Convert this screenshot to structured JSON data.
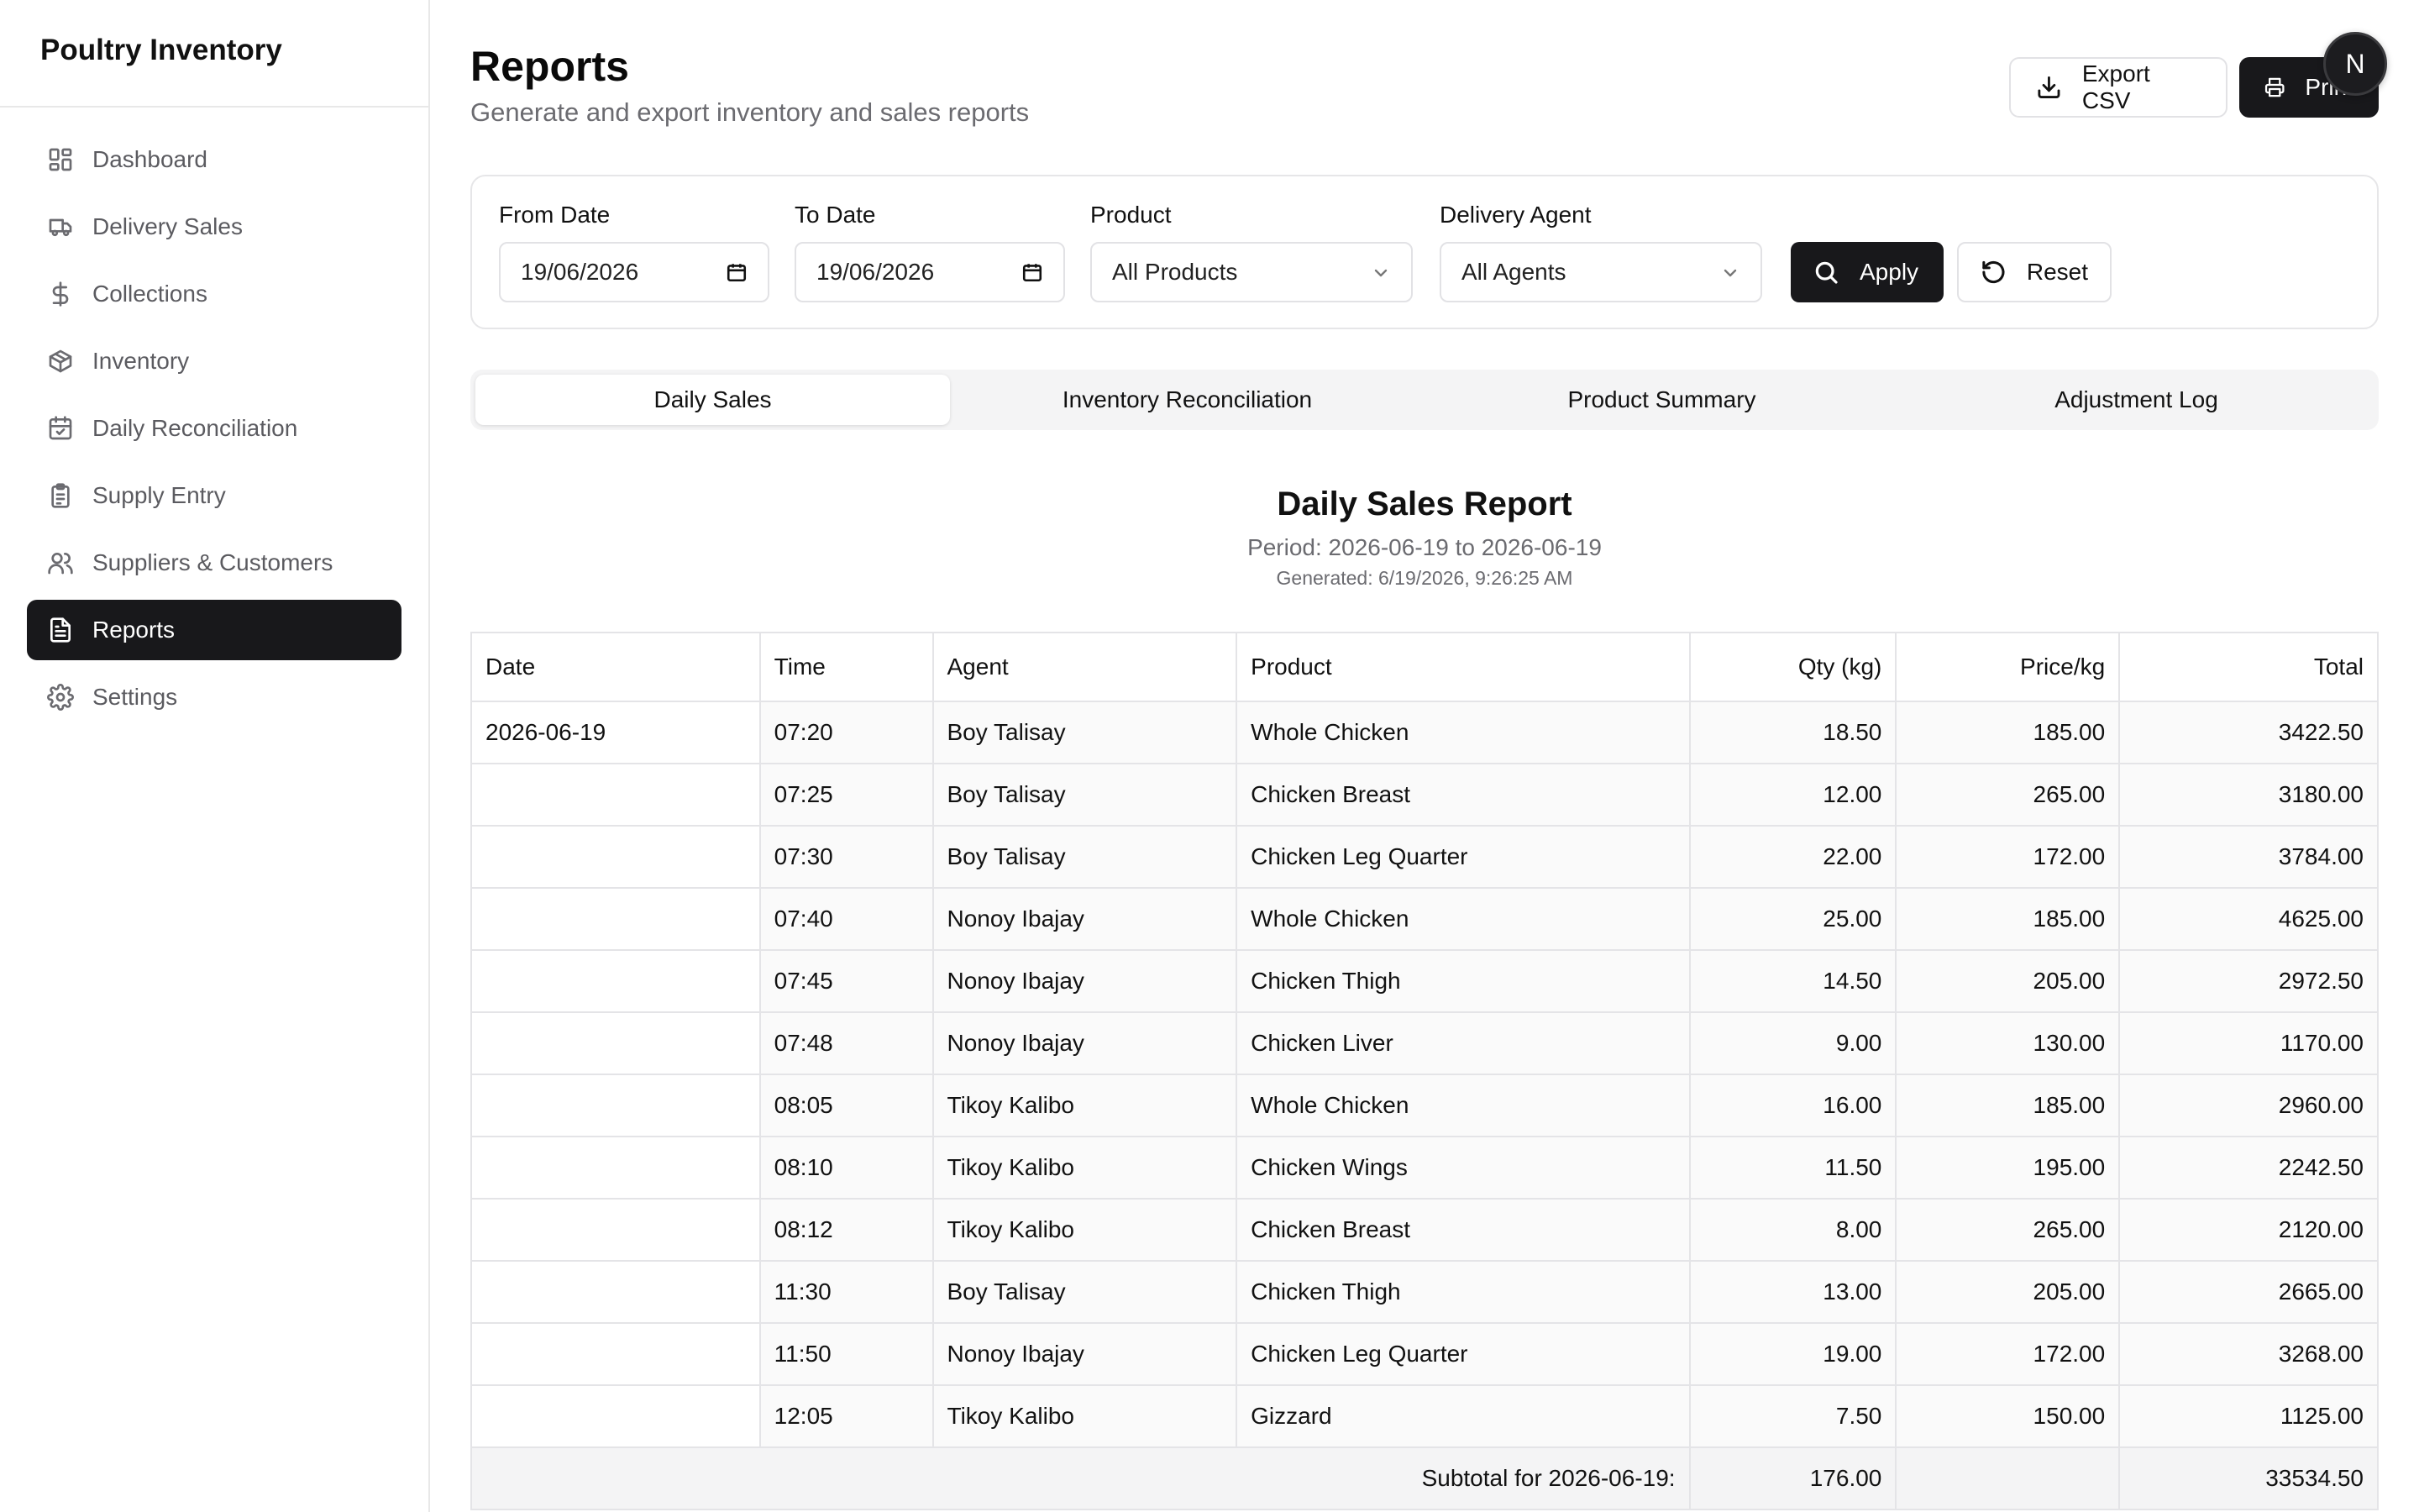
{
  "app": {
    "title": "Poultry Inventory"
  },
  "sidebar": {
    "items": [
      {
        "label": "Dashboard",
        "icon": "dashboard-icon"
      },
      {
        "label": "Delivery Sales",
        "icon": "truck-icon"
      },
      {
        "label": "Collections",
        "icon": "dollar-icon"
      },
      {
        "label": "Inventory",
        "icon": "package-icon"
      },
      {
        "label": "Daily Reconciliation",
        "icon": "calendar-check-icon"
      },
      {
        "label": "Supply Entry",
        "icon": "clipboard-icon"
      },
      {
        "label": "Suppliers & Customers",
        "icon": "users-icon"
      },
      {
        "label": "Reports",
        "icon": "file-text-icon",
        "active": true
      },
      {
        "label": "Settings",
        "icon": "gear-icon"
      }
    ]
  },
  "header": {
    "title": "Reports",
    "subtitle": "Generate and export inventory and sales reports",
    "export_label": "Export CSV",
    "print_label": "Print",
    "avatar_initial": "N"
  },
  "filters": {
    "from_label": "From Date",
    "from_value": "19/06/2026",
    "to_label": "To Date",
    "to_value": "19/06/2026",
    "product_label": "Product",
    "product_value": "All Products",
    "agent_label": "Delivery Agent",
    "agent_value": "All Agents",
    "apply_label": "Apply",
    "reset_label": "Reset"
  },
  "tabs": [
    {
      "label": "Daily Sales",
      "active": true
    },
    {
      "label": "Inventory Reconciliation"
    },
    {
      "label": "Product Summary"
    },
    {
      "label": "Adjustment Log"
    }
  ],
  "report": {
    "title": "Daily Sales Report",
    "period": "Period: 2026-06-19 to 2026-06-19",
    "generated": "Generated: 6/19/2026, 9:26:25 AM",
    "columns": [
      "Date",
      "Time",
      "Agent",
      "Product",
      "Qty (kg)",
      "Price/kg",
      "Total"
    ],
    "rows": [
      {
        "date": "2026-06-19",
        "time": "07:20",
        "agent": "Boy Talisay",
        "product": "Whole Chicken",
        "qty": "18.50",
        "price": "185.00",
        "total": "3422.50"
      },
      {
        "date": "",
        "time": "07:25",
        "agent": "Boy Talisay",
        "product": "Chicken Breast",
        "qty": "12.00",
        "price": "265.00",
        "total": "3180.00"
      },
      {
        "date": "",
        "time": "07:30",
        "agent": "Boy Talisay",
        "product": "Chicken Leg Quarter",
        "qty": "22.00",
        "price": "172.00",
        "total": "3784.00"
      },
      {
        "date": "",
        "time": "07:40",
        "agent": "Nonoy Ibajay",
        "product": "Whole Chicken",
        "qty": "25.00",
        "price": "185.00",
        "total": "4625.00"
      },
      {
        "date": "",
        "time": "07:45",
        "agent": "Nonoy Ibajay",
        "product": "Chicken Thigh",
        "qty": "14.50",
        "price": "205.00",
        "total": "2972.50"
      },
      {
        "date": "",
        "time": "07:48",
        "agent": "Nonoy Ibajay",
        "product": "Chicken Liver",
        "qty": "9.00",
        "price": "130.00",
        "total": "1170.00"
      },
      {
        "date": "",
        "time": "08:05",
        "agent": "Tikoy Kalibo",
        "product": "Whole Chicken",
        "qty": "16.00",
        "price": "185.00",
        "total": "2960.00"
      },
      {
        "date": "",
        "time": "08:10",
        "agent": "Tikoy Kalibo",
        "product": "Chicken Wings",
        "qty": "11.50",
        "price": "195.00",
        "total": "2242.50"
      },
      {
        "date": "",
        "time": "08:12",
        "agent": "Tikoy Kalibo",
        "product": "Chicken Breast",
        "qty": "8.00",
        "price": "265.00",
        "total": "2120.00"
      },
      {
        "date": "",
        "time": "11:30",
        "agent": "Boy Talisay",
        "product": "Chicken Thigh",
        "qty": "13.00",
        "price": "205.00",
        "total": "2665.00"
      },
      {
        "date": "",
        "time": "11:50",
        "agent": "Nonoy Ibajay",
        "product": "Chicken Leg Quarter",
        "qty": "19.00",
        "price": "172.00",
        "total": "3268.00"
      },
      {
        "date": "",
        "time": "12:05",
        "agent": "Tikoy Kalibo",
        "product": "Gizzard",
        "qty": "7.50",
        "price": "150.00",
        "total": "1125.00"
      }
    ],
    "subtotal": {
      "label": "Subtotal for 2026-06-19:",
      "qty": "176.00",
      "total": "33534.50"
    }
  }
}
